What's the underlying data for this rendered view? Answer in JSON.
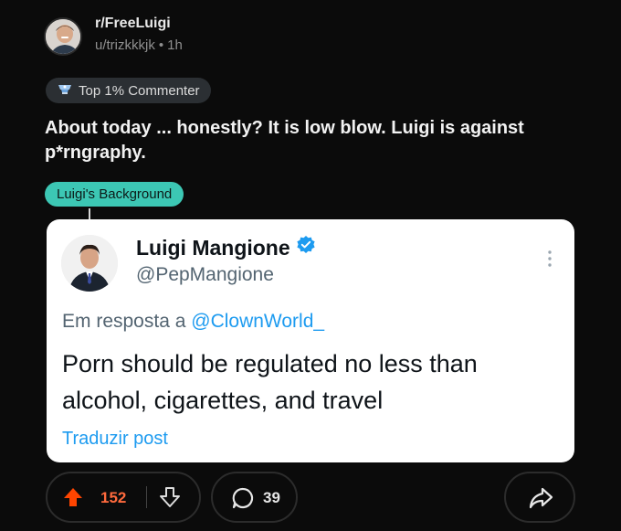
{
  "post": {
    "subreddit": "r/FreeLuigi",
    "author": "u/trizkkkjk",
    "separator": "•",
    "age": "1h",
    "user_flair": "Top 1% Commenter",
    "title": "About today ... honestly? It is low blow. Luigi is against p*rngraphy.",
    "post_flair": "Luigi's Background"
  },
  "tweet": {
    "display_name": "Luigi Mangione",
    "handle": "@PepMangione",
    "reply_prefix": "Em resposta a",
    "reply_mention": "@ClownWorld_",
    "text": "Porn should be regulated no less than alcohol, cigarettes, and travel",
    "translate_label": "Traduzir post",
    "verified": true
  },
  "actions": {
    "upvotes": "152",
    "comments": "39"
  },
  "icons": {
    "avatar": "user-avatar-icon",
    "flair": "trophy-icon",
    "verified": "verified-badge-icon",
    "more": "more-options-icon",
    "upvote": "upvote-arrow-icon",
    "downvote": "downvote-arrow-icon",
    "comment": "comment-bubble-icon",
    "share": "share-arrow-icon"
  },
  "colors": {
    "background": "#0b0b0b",
    "post_flair_bg": "#3cc7b4",
    "upvote_active": "#ff4500",
    "link_blue": "#1d9bf0",
    "verified_blue": "#1d9bf0"
  }
}
